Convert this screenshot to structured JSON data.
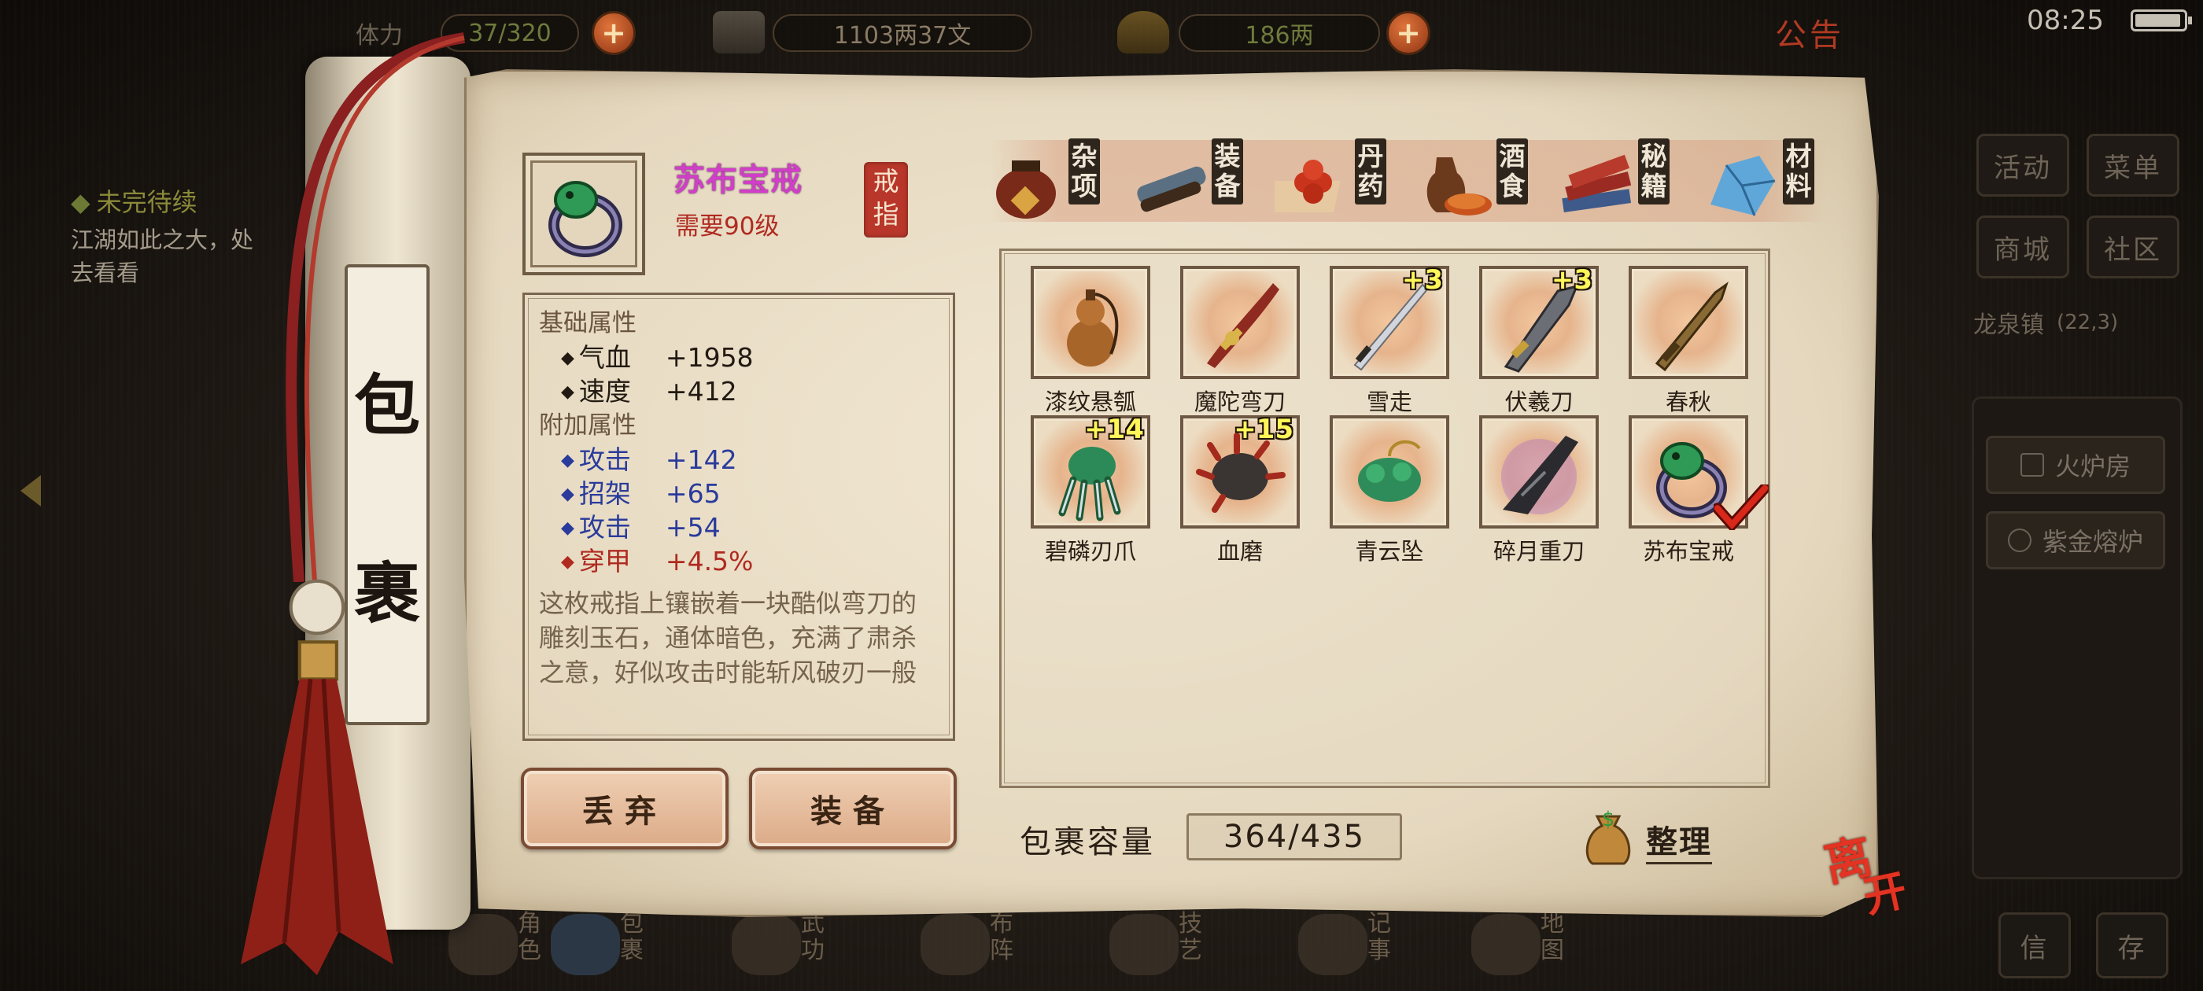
{
  "topbar": {
    "stamina_label": "体力",
    "stamina_value": "37/320",
    "money": "1103两37文",
    "gold": "186两",
    "notice": "公告",
    "time": "08:25"
  },
  "quest": {
    "title": "未完待续",
    "text": "江湖如此之大，处去看看"
  },
  "right_menu": {
    "buttons": [
      "活动",
      "菜单",
      "商城",
      "社区"
    ],
    "town": "龙泉镇",
    "town_coord": "(22,3)",
    "facilities": [
      "火炉房",
      "紫金熔炉"
    ]
  },
  "bottom_nav": [
    "角色",
    "包裹",
    "武功",
    "布阵",
    "技艺",
    "记事",
    "地图",
    "信",
    "存"
  ],
  "scroll_label": [
    "包",
    "裹"
  ],
  "item": {
    "name": "苏布宝戒",
    "requirement": "需要90级",
    "type_seal": "戒指",
    "base_header": "基础属性",
    "base_attrs": [
      {
        "key": "气血",
        "value": "+1958"
      },
      {
        "key": "速度",
        "value": "+412"
      }
    ],
    "extra_header": "附加属性",
    "extra_attrs": [
      {
        "key": "攻击",
        "value": "+142",
        "color": "blue"
      },
      {
        "key": "招架",
        "value": "+65",
        "color": "blue"
      },
      {
        "key": "攻击",
        "value": "+54",
        "color": "blue"
      },
      {
        "key": "穿甲",
        "value": "+4.5%",
        "color": "red"
      }
    ],
    "description": "这枚戒指上镶嵌着一块酷似弯刀的雕刻玉石，通体暗色，充满了肃杀之意，好似攻击时能斩风破刃一般"
  },
  "actions": {
    "discard": "丢弃",
    "equip": "装备"
  },
  "tabs": [
    {
      "label": "杂项",
      "icon": "jar-icon"
    },
    {
      "label": "装备",
      "icon": "scroll-bundle-icon"
    },
    {
      "label": "丹药",
      "icon": "pills-icon"
    },
    {
      "label": "酒食",
      "icon": "food-icon"
    },
    {
      "label": "秘籍",
      "icon": "books-icon"
    },
    {
      "label": "材料",
      "icon": "crystal-icon"
    }
  ],
  "inventory": [
    {
      "name": "漆纹悬瓠",
      "plus": "",
      "icon": "gourd-icon"
    },
    {
      "name": "魔陀弯刀",
      "plus": "",
      "icon": "curved-blade-icon"
    },
    {
      "name": "雪走",
      "plus": "+3",
      "icon": "katana-icon"
    },
    {
      "name": "伏羲刀",
      "plus": "+3",
      "icon": "broad-blade-icon"
    },
    {
      "name": "春秋",
      "plus": "",
      "icon": "sword-icon"
    },
    {
      "name": "碧磷刃爪",
      "plus": "+14",
      "icon": "claw-icon"
    },
    {
      "name": "血磨",
      "plus": "+15",
      "icon": "spiked-gauntlet-icon"
    },
    {
      "name": "青云坠",
      "plus": "",
      "icon": "jade-pendant-icon"
    },
    {
      "name": "碎月重刀",
      "plus": "",
      "icon": "heavy-blade-icon"
    },
    {
      "name": "苏布宝戒",
      "plus": "",
      "icon": "ring-icon",
      "selected": true
    }
  ],
  "capacity": {
    "label": "包裹容量",
    "value": "364/435"
  },
  "sort_label": "整理",
  "leave_label": [
    "离",
    "开"
  ],
  "colors": {
    "item_name": "#d13ec8",
    "requirement": "#b12b22",
    "extra_attr_blue": "#2a3b9c",
    "extra_attr_red": "#b02a20"
  }
}
